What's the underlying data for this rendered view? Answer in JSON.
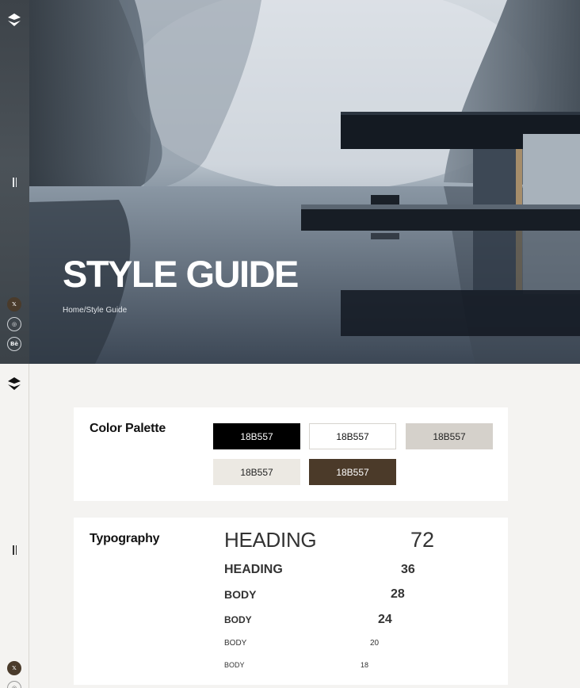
{
  "hero": {
    "title": "STYLE GUIDE",
    "breadcrumb": {
      "home": "Home",
      "separator": "/",
      "current": "Style Guide"
    }
  },
  "rail": {
    "logo_icon": "brand-logo-icon",
    "menu_icon": "menu-toggle-icon",
    "social": [
      {
        "name": "x-twitter-icon",
        "glyph": "𝕏"
      },
      {
        "name": "instagram-icon",
        "glyph": "◎"
      },
      {
        "name": "behance-icon",
        "glyph": "Bē"
      }
    ]
  },
  "palette": {
    "title": "Color Palette",
    "swatches": [
      {
        "label": "18B557",
        "bg": "#000000",
        "fg": "#ffffff",
        "border": "#000000"
      },
      {
        "label": "18B557",
        "bg": "#ffffff",
        "fg": "#111111",
        "border": "#d6d3ce"
      },
      {
        "label": "18B557",
        "bg": "#d5d1cb",
        "fg": "#222222",
        "border": "#d5d1cb"
      },
      {
        "label": "18B557",
        "bg": "#ece9e3",
        "fg": "#222222",
        "border": "#ece9e3"
      },
      {
        "label": "18B557",
        "bg": "#4b3a29",
        "fg": "#ffffff",
        "border": "#4b3a29"
      }
    ]
  },
  "typography": {
    "title": "Typography",
    "rows": [
      {
        "label": "HEADING",
        "size": "72"
      },
      {
        "label": "HEADING",
        "size": "36"
      },
      {
        "label": "BODY",
        "size": "28"
      },
      {
        "label": "BODY",
        "size": "24"
      },
      {
        "label": "BODY",
        "size": "20"
      },
      {
        "label": "BODY",
        "size": "18"
      }
    ]
  }
}
